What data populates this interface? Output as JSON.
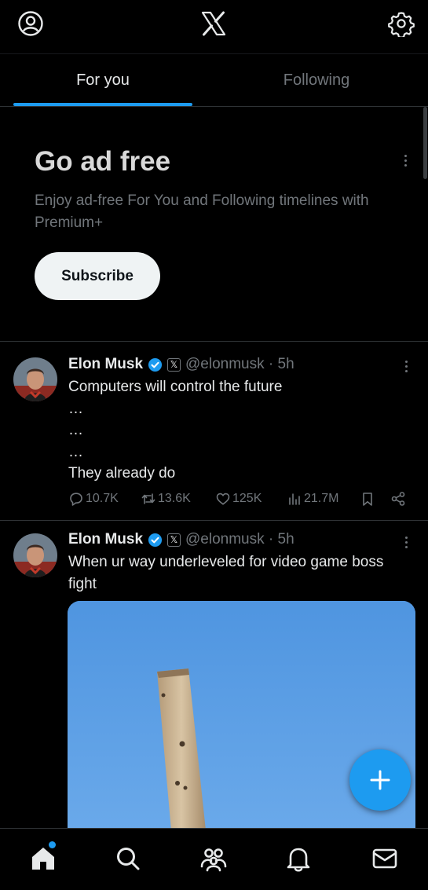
{
  "app": {
    "logo_icon": "x-logo-icon",
    "accent_color": "#1d9bf0"
  },
  "tabs": [
    {
      "label": "For you",
      "active": true
    },
    {
      "label": "Following",
      "active": false
    }
  ],
  "promo": {
    "title": "Go ad free",
    "description": "Enjoy ad-free For You and Following timelines with Premium+",
    "button_label": "Subscribe"
  },
  "tweets": [
    {
      "name": "Elon Musk",
      "handle": "@elonmusk · 5h",
      "lines": [
        "Computers will control the future",
        "…",
        "…",
        "…",
        "They already do"
      ],
      "replies": "10.7K",
      "reposts": "13.6K",
      "likes": "125K",
      "views": "21.7M"
    },
    {
      "name": "Elon Musk",
      "handle": "@elonmusk · 5h",
      "lines": [
        "When ur way underleveled for video game boss fight"
      ]
    }
  ],
  "bottom_nav": [
    "home-icon",
    "search-icon",
    "communities-icon",
    "notifications-icon",
    "messages-icon"
  ]
}
